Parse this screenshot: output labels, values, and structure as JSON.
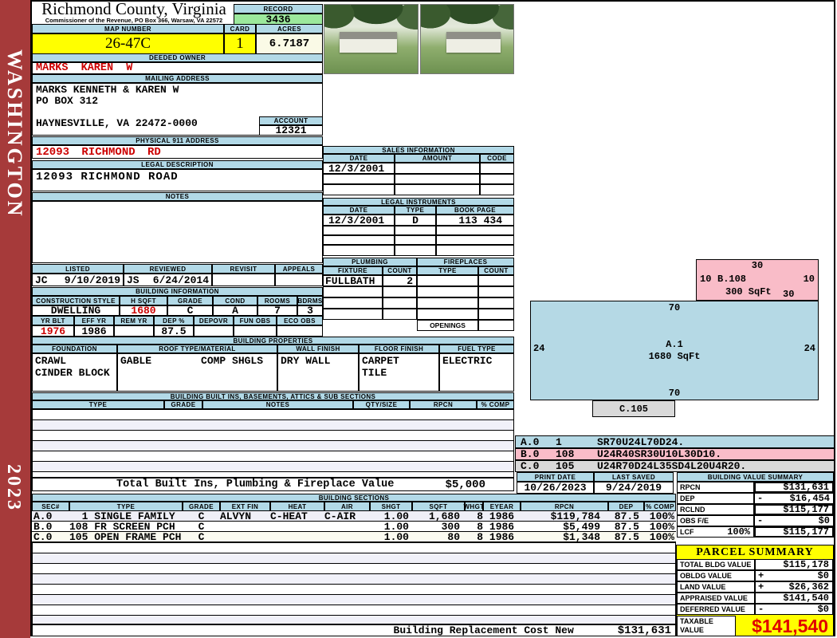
{
  "sidebar": {
    "district": "WASHINGTON",
    "year": "2023"
  },
  "colors": {
    "accent_blue": "#B2D9E7",
    "record_green": "#9CE89C",
    "highlight_yellow": "#FFFF00",
    "value_red": "#CC0000",
    "sidebar_red": "#A63A3A",
    "sketch_blue": "#B5D9E5",
    "sketch_pink": "#F9BCC8",
    "sketch_gray": "#D9D9D9"
  },
  "header": {
    "county": "Richmond County, Virginia",
    "subtitle": "Commissioner of the Revenue, PO Box 366, Warsaw, VA 22572",
    "record_label": "RECORD",
    "record_value": "3436",
    "map_number_label": "MAP NUMBER",
    "map_number": "26-47C",
    "card_label": "CARD",
    "card": "1",
    "acres_label": "ACRES",
    "acres": "6.7187"
  },
  "owner": {
    "deeded_owner_label": "DEEDED OWNER",
    "deeded_owner": "MARKS KAREN W",
    "mailing_address_label": "MAILING ADDRESS",
    "mailing_address": "MARKS KENNETH & KAREN W\nPO BOX 312\n\nHAYNESVILLE, VA 22472-0000",
    "account_label": "ACCOUNT",
    "account": "12321",
    "physical_address_label": "PHYSICAL 911 ADDRESS",
    "physical_address": "12093 RICHMOND RD",
    "legal_description_label": "LEGAL DESCRIPTION",
    "legal_description": "12093 RICHMOND ROAD",
    "notes_label": "NOTES",
    "notes": ""
  },
  "visits": {
    "headers": [
      "LISTED",
      "REVIEWED",
      "REVISIT",
      "APPEALS"
    ],
    "listed_by": "JC",
    "listed_date": "9/10/2019",
    "reviewed_by": "JS",
    "reviewed_date": "6/24/2014",
    "revisit": "",
    "appeals": ""
  },
  "sales": {
    "title": "SALES INFORMATION",
    "headers": [
      "DATE",
      "AMOUNT",
      "CODE"
    ],
    "rows": [
      [
        "12/3/2001",
        "",
        ""
      ],
      [
        "",
        "",
        ""
      ],
      [
        "",
        "",
        ""
      ]
    ]
  },
  "legal_instruments": {
    "title": "LEGAL INSTRUMENTS",
    "headers": [
      "DATE",
      "TYPE",
      "BOOK PAGE"
    ],
    "rows": [
      [
        "12/3/2001",
        "D",
        "113 434"
      ],
      [
        "",
        "",
        ""
      ],
      [
        "",
        "",
        ""
      ],
      [
        "",
        "",
        ""
      ]
    ]
  },
  "plumbing": {
    "title": "PLUMBING",
    "headers": [
      "FIXTURE",
      "COUNT"
    ],
    "rows": [
      [
        "FULLBATH",
        "2"
      ],
      [
        "",
        ""
      ],
      [
        "",
        ""
      ],
      [
        "",
        ""
      ]
    ]
  },
  "fireplaces": {
    "title": "FIREPLACES",
    "headers": [
      "TYPE",
      "COUNT"
    ],
    "rows": [
      [
        "",
        ""
      ],
      [
        "",
        ""
      ],
      [
        "",
        ""
      ],
      [
        "",
        ""
      ]
    ],
    "openings_label": "OPENINGS",
    "openings": ""
  },
  "building_information": {
    "title": "BUILDING INFORMATION",
    "style_headers": [
      "CONSTRUCTION STYLE",
      "H SQFT",
      "GRADE",
      "COND",
      "ROOMS",
      "BDRMS"
    ],
    "style_values": [
      "DWELLING",
      "1680",
      "C",
      "A",
      "7",
      "3"
    ],
    "year_headers": [
      "YR BLT",
      "EFF YR",
      "REM YR",
      "DEP %",
      "DEPOVR",
      "FUN OBS",
      "ECO OBS"
    ],
    "year_values": [
      "1976",
      "1986",
      "",
      "87.5",
      "",
      "",
      ""
    ]
  },
  "building_properties": {
    "title": "BUILDING PROPERTIES",
    "headers": [
      "FOUNDATION",
      "ROOF TYPE/MATERIAL",
      "WALL FINISH",
      "FLOOR FINISH",
      "FUEL TYPE"
    ],
    "foundation": "CRAWL\nCINDER BLOCK",
    "roof_type": "GABLE",
    "roof_material": "COMP SHGLS",
    "wall_finish": "DRY WALL",
    "floor_finish": "CARPET\nTILE",
    "fuel_type": "ELECTRIC"
  },
  "built_ins": {
    "title": "BUILDING BUILT INS, BASEMENTS, ATTICS & SUB SECTIONS",
    "headers": [
      "TYPE",
      "GRADE",
      "NOTES",
      "QTY/SIZE",
      "RPCN",
      "% COMP"
    ],
    "total_label": "Total Built Ins, Plumbing & Fireplace Value",
    "total_value": "$5,000"
  },
  "sketch": {
    "a": {
      "id": "A.1",
      "sqft": "1680 SqFt",
      "top": "70",
      "bottom": "70",
      "left": "24",
      "right": "24"
    },
    "b": {
      "id": "B.108",
      "sqft": "300 SqFt",
      "top": "30",
      "bottom": "30",
      "left": "10",
      "right": "10"
    },
    "c": {
      "id": "C.105"
    },
    "legend": [
      {
        "code": "A.0",
        "num": "1",
        "path": "SR70U24L70D24."
      },
      {
        "code": "B.0",
        "num": "108",
        "path": "U24R40SR30U10L30D10."
      },
      {
        "code": "C.0",
        "num": "105",
        "path": "U24R70D24L35SD4L20U4R20."
      }
    ]
  },
  "dates": {
    "print_date_label": "PRINT DATE",
    "print_date": "10/26/2023",
    "last_saved_label": "LAST SAVED",
    "last_saved": "9/24/2019"
  },
  "building_value_summary": {
    "title": "BUILDING VALUE SUMMARY",
    "rows": [
      {
        "label": "RPCN",
        "pct": "",
        "op": "",
        "value": "$131,631"
      },
      {
        "label": "DEP",
        "pct": "",
        "op": "-",
        "value": "$16,454"
      },
      {
        "label": "RCLND",
        "pct": "",
        "op": "",
        "value": "$115,177"
      },
      {
        "label": "OBS F/E",
        "pct": "",
        "op": "-",
        "value": "$0"
      },
      {
        "label": "LCF",
        "pct": "100%",
        "op": "",
        "value": "$115,177"
      }
    ]
  },
  "building_sections": {
    "title": "BUILDING SECTIONS",
    "headers": [
      "SEC#",
      "TYPE",
      "GRADE",
      "EXT FIN",
      "HEAT",
      "AIR",
      "SHGT",
      "SQFT",
      "WHGT",
      "EYEAR",
      "RPCN",
      "DEP",
      "% COMP"
    ],
    "rows": [
      [
        "A.0",
        "  1 SINGLE FAMILY",
        "C",
        "ALVYN",
        "C-HEAT",
        "C-AIR",
        "1.00",
        "1,680",
        "8",
        "1986",
        "$119,784",
        "87.5",
        "100%"
      ],
      [
        "B.0",
        "108 FR SCREEN PCH",
        "C",
        "",
        "",
        "",
        "1.00",
        "300",
        "8",
        "1986",
        "$5,499",
        "87.5",
        "100%"
      ],
      [
        "C.0",
        "105 OPEN FRAME PCH",
        "C",
        "",
        "",
        "",
        "1.00",
        "80",
        "8",
        "1986",
        "$1,348",
        "87.5",
        "100%"
      ]
    ],
    "footer_label": "Building Replacement Cost New",
    "footer_value": "$131,631"
  },
  "parcel_summary": {
    "title": "PARCEL SUMMARY",
    "rows": [
      {
        "label": "TOTAL BLDG VALUE",
        "op": "",
        "value": "$115,178"
      },
      {
        "label": "OBLDG VALUE",
        "op": "+",
        "value": "$0"
      },
      {
        "label": "LAND VALUE",
        "op": "+",
        "value": "$26,362"
      },
      {
        "label": "APPRAISED VALUE",
        "op": "",
        "value": "$141,540"
      },
      {
        "label": "DEFERRED VALUE",
        "op": "-",
        "value": "$0"
      }
    ],
    "taxable_label": "TAXABLE\nVALUE",
    "taxable_value": "$141,540"
  }
}
